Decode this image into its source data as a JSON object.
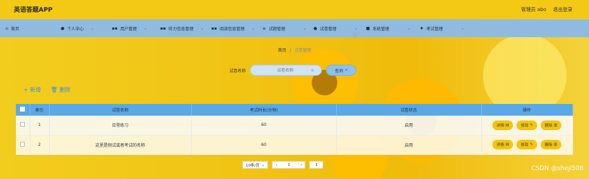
{
  "header": {
    "title": "英语答题APP",
    "user_label": "管理员 abo",
    "logout_label": "退出登录"
  },
  "nav": {
    "items": [
      {
        "label": "首页",
        "icon": "home-icon"
      },
      {
        "label": "个人中心",
        "icon": "user-icon"
      },
      {
        "label": "用户管理",
        "icon": "grid-icon"
      },
      {
        "label": "听力信息管理",
        "icon": "grid-icon"
      },
      {
        "label": "阅读信息管理",
        "icon": "grid-icon"
      },
      {
        "label": "试题管理",
        "icon": "list-icon"
      },
      {
        "label": "试卷管理",
        "icon": "user-icon"
      },
      {
        "label": "系统管理",
        "icon": "monitor-icon"
      },
      {
        "label": "考试管理",
        "icon": "pin-icon"
      }
    ]
  },
  "breadcrumb": {
    "home": "首页",
    "separator": "/",
    "current": "试卷管理"
  },
  "search": {
    "label": "试卷名称",
    "placeholder": "试卷名称",
    "value": "",
    "button_label": "查询"
  },
  "actions": {
    "add_label": "+ 新增",
    "delete_label": "删除"
  },
  "table": {
    "headers": [
      "索引",
      "试卷名称",
      "考试时长(分钟)",
      "试卷状态",
      "操作"
    ],
    "rows": [
      {
        "index": "1",
        "name": "日常练习",
        "duration": "60",
        "status": "启用"
      },
      {
        "index": "2",
        "name": "这里是刚试或者考试的名称",
        "duration": "60",
        "status": "启用"
      }
    ],
    "op_labels": {
      "detail": "详情",
      "edit": "修改",
      "delete": "删除"
    }
  },
  "pagination": {
    "page_size": "10条/页",
    "current_page": "1",
    "goto_page": "1"
  },
  "watermark": "CSDN @sheji508",
  "colors": {
    "header_bg": "#f4c915",
    "nav_bg": "#8fbbe0",
    "table_head_bg": "#5aa8e8",
    "button_yellow": "#f2c514",
    "accent_blue": "#3a8fd6"
  }
}
